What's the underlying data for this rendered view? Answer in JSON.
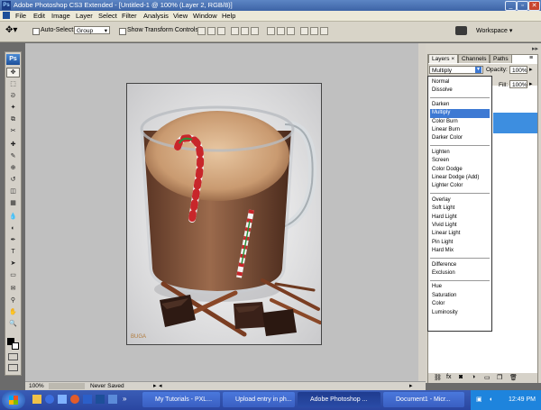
{
  "window": {
    "app_icon": "Ps",
    "title": "Adobe Photoshop CS3 Extended - [Untitled-1 @ 100% (Layer 2, RGB/8)]"
  },
  "menu": [
    "File",
    "Edit",
    "Image",
    "Layer",
    "Select",
    "Filter",
    "Analysis",
    "View",
    "Window",
    "Help"
  ],
  "options_bar": {
    "auto_select_label": "Auto-Select:",
    "auto_select_value": "Group",
    "show_transform_label": "Show Transform Controls",
    "workspace_label": "Workspace"
  },
  "toolbox": {
    "logo": "Ps",
    "tools": [
      "move-icon",
      "marquee-icon",
      "lasso-icon",
      "magic-wand-icon",
      "crop-icon",
      "slice-icon",
      "healing-icon",
      "brush-icon",
      "clone-stamp-icon",
      "history-brush-icon",
      "eraser-icon",
      "gradient-icon",
      "blur-icon",
      "dodge-icon",
      "pen-icon",
      "type-icon",
      "path-select-icon",
      "shape-icon",
      "notes-icon",
      "eyedropper-icon",
      "hand-icon",
      "zoom-icon"
    ],
    "tool_glyphs": [
      "✥",
      "⬚",
      "ᘐ",
      "✦",
      "⧉",
      "✂",
      "✚",
      "✎",
      "⊕",
      "↺",
      "◫",
      "▦",
      "💧",
      "◐",
      "✒",
      "T",
      "➤",
      "▭",
      "✉",
      "⚲",
      "✋",
      "🔍"
    ]
  },
  "document": {
    "watermark": "BUGA"
  },
  "status": {
    "zoom": "100%",
    "info": "Never Saved"
  },
  "layers_panel": {
    "tabs": [
      "Layers ×",
      "Channels",
      "Paths"
    ],
    "blend_mode": "Multiply",
    "opacity_label": "Opacity:",
    "opacity_value": "100%",
    "fill_label": "Fill:",
    "fill_value": "100%",
    "blend_groups": [
      [
        "Normal",
        "Dissolve"
      ],
      [
        "Darken",
        "Multiply",
        "Color Burn",
        "Linear Burn",
        "Darker Color"
      ],
      [
        "Lighten",
        "Screen",
        "Color Dodge",
        "Linear Dodge (Add)",
        "Lighter Color"
      ],
      [
        "Overlay",
        "Soft Light",
        "Hard Light",
        "Vivid Light",
        "Linear Light",
        "Pin Light",
        "Hard Mix"
      ],
      [
        "Difference",
        "Exclusion"
      ],
      [
        "Hue",
        "Saturation",
        "Color",
        "Luminosity"
      ]
    ],
    "selected_mode": "Multiply",
    "accent": "#3d79d3"
  },
  "taskbar": {
    "start_icon": "windows-logo-icon",
    "tasks": [
      {
        "label": "My Tutorials - PXL...",
        "active": false
      },
      {
        "label": "Upload entry in ph...",
        "active": false
      },
      {
        "label": "Adobe Photoshop ...",
        "active": true
      },
      {
        "label": "Document1 - Micr...",
        "active": false
      }
    ],
    "clock": "12:49 PM"
  }
}
